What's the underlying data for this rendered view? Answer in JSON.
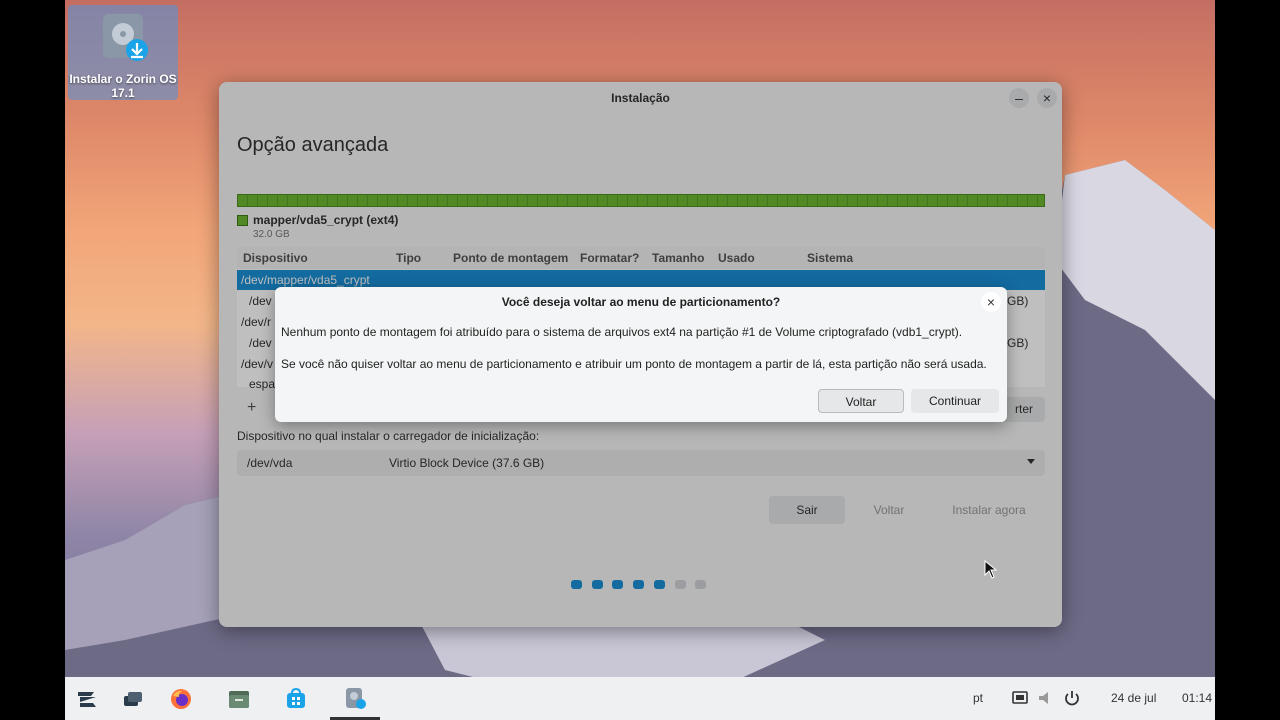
{
  "desktop": {
    "install_icon_label": "Instalar o Zorin OS 17.1"
  },
  "window": {
    "title": "Instalação",
    "heading": "Opção avançada",
    "partition": {
      "name": "mapper/vda5_crypt (ext4)",
      "size": "32.0 GB",
      "color": "#6cb830"
    },
    "table": {
      "headers": [
        "Dispositivo",
        "Tipo",
        "Ponto de montagem",
        "Formatar?",
        "Tamanho",
        "Usado",
        "Sistema"
      ],
      "rows": [
        {
          "device": "/dev/mapper/vda5_crypt",
          "right": ""
        },
        {
          "device": "/dev",
          "right": "GB)"
        },
        {
          "device": "/dev/r",
          "right": ""
        },
        {
          "device": "/dev",
          "right": "GB)"
        },
        {
          "device": "/dev/v",
          "right": ""
        },
        {
          "device": "espa",
          "right": ""
        }
      ]
    },
    "add_label": "+",
    "revert_label": "rter",
    "bootloader_label": "Dispositivo no qual instalar o carregador de inicialização:",
    "bootloader_device": "/dev/vda",
    "bootloader_desc": "Virtio Block Device (37.6 GB)",
    "buttons": {
      "quit": "Sair",
      "back": "Voltar",
      "install": "Instalar agora"
    },
    "progress": {
      "total_steps": 7,
      "completed_steps": 5,
      "accent": "#1a8fd6"
    }
  },
  "dialog": {
    "title": "Você deseja voltar ao menu de particionamento?",
    "text1": "Nenhum ponto de montagem foi atribuído para o sistema de arquivos ext4 na partição #1 de Volume criptografado (vdb1_crypt).",
    "text2": "Se você não quiser voltar ao menu de particionamento e atribuir um ponto de montagem a partir de lá, esta partição não será usada.",
    "voltar": "Voltar",
    "continuar": "Continuar"
  },
  "taskbar": {
    "keyboard_layout": "pt",
    "date": "24 de jul",
    "time": "01:14"
  }
}
